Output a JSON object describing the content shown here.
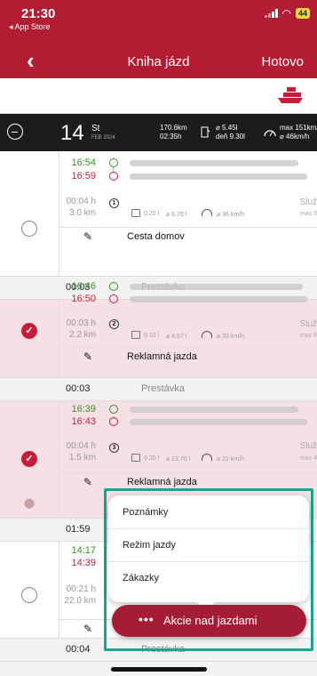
{
  "status_bar": {
    "time": "21:30",
    "back_app": "◂ App Store",
    "battery": "44"
  },
  "nav": {
    "back_icon": "chevron-left-icon",
    "title": "Kniha jázd",
    "done": "Hotovo"
  },
  "toolbar": {
    "icon": "boat-icon"
  },
  "day_header": {
    "day": "14",
    "day_name": "St",
    "month_year": "FEB 2024",
    "distance": "170.6km",
    "duration": "02:35h",
    "fuel_avg": "⌀ 5.45l",
    "fuel_day": "deň 9.30l",
    "speed_max": "max 151km/h",
    "speed_avg": "⌀ 46km/h"
  },
  "trips": [
    {
      "start": "16:54",
      "end": "16:59",
      "duration": "00:04 h",
      "distance": "3.0 km",
      "number": "1",
      "fuel": "0.20 l",
      "fuel_avg": "⌀ 6.76 l",
      "speed": "⌀ 36 km/h",
      "type": "Služ",
      "max": "max 5",
      "purpose": "Cesta domov",
      "selected": false
    },
    {
      "start": "16:46",
      "end": "16:50",
      "duration": "00:03 h",
      "distance": "2.2 km",
      "number": "2",
      "fuel": "0.10 l",
      "fuel_avg": "⌀ 4.57 l",
      "speed": "⌀ 33 km/h",
      "type": "Služ",
      "max": "max 6",
      "purpose": "Reklamná jazda",
      "selected": true
    },
    {
      "start": "16:39",
      "end": "16:43",
      "duration": "00:04 h",
      "distance": "1.5 km",
      "number": "3",
      "fuel": "0.20 l",
      "fuel_avg": "⌀ 13.70 l",
      "speed": "⌀ 21 km/h",
      "type": "Služ",
      "max": "max 4",
      "purpose": "Reklamná jazda",
      "selected": true
    },
    {
      "start": "14:17",
      "end": "14:39",
      "duration": "00:21 h",
      "distance": "22.0 km",
      "selected": false
    }
  ],
  "breaks": [
    {
      "time": "00:03",
      "label": "Prestávka"
    },
    {
      "time": "00:03",
      "label": "Prestávka"
    },
    {
      "time": "01:59",
      "label": ""
    },
    {
      "time": "00:04",
      "label": "Prestávka"
    }
  ],
  "popup_menu": {
    "items": [
      "Poznámky",
      "Režim jazdy",
      "Zákazky"
    ]
  },
  "action_button": {
    "label": "Akcie nad jazdami",
    "icon": "more-dots-icon"
  },
  "colors": {
    "brand": "#b21d33",
    "selected_bg": "#f5e1e5",
    "highlight": "#1aa58f"
  }
}
